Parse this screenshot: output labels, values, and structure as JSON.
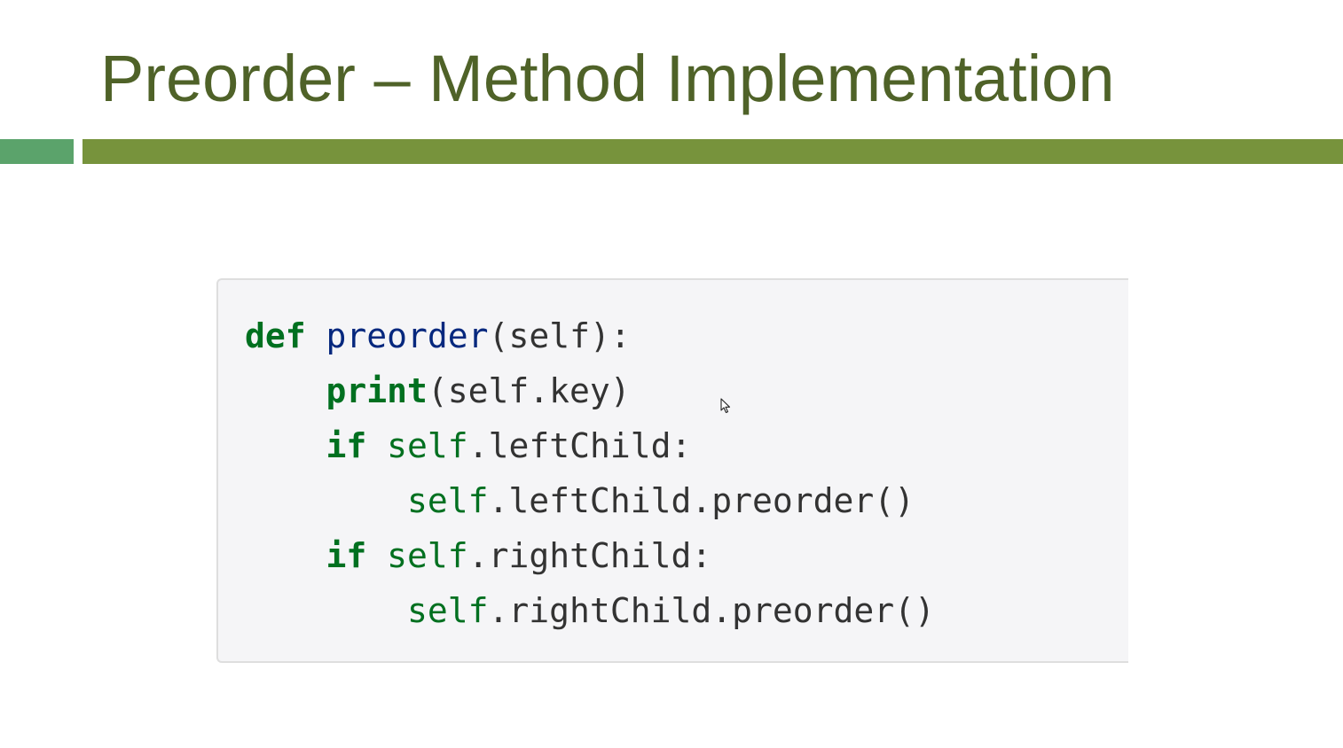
{
  "slide": {
    "title": "Preorder – Method Implementation"
  },
  "code": {
    "lines": [
      [
        {
          "text": "def",
          "kind": "kw"
        },
        {
          "text": " ",
          "kind": "pn"
        },
        {
          "text": "preorder",
          "kind": "fn"
        },
        {
          "text": "(self):",
          "kind": "pn"
        }
      ],
      [
        {
          "text": "    ",
          "kind": "pn"
        },
        {
          "text": "print",
          "kind": "kw"
        },
        {
          "text": "(self.key)",
          "kind": "pn"
        }
      ],
      [
        {
          "text": "    ",
          "kind": "pn"
        },
        {
          "text": "if",
          "kind": "kw"
        },
        {
          "text": " ",
          "kind": "pn"
        },
        {
          "text": "self",
          "kind": "bi"
        },
        {
          "text": ".leftChild:",
          "kind": "pn"
        }
      ],
      [
        {
          "text": "        ",
          "kind": "pn"
        },
        {
          "text": "self",
          "kind": "bi"
        },
        {
          "text": ".leftChild.preorder()",
          "kind": "pn"
        }
      ],
      [
        {
          "text": "    ",
          "kind": "pn"
        },
        {
          "text": "if",
          "kind": "kw"
        },
        {
          "text": " ",
          "kind": "pn"
        },
        {
          "text": "self",
          "kind": "bi"
        },
        {
          "text": ".rightChild:",
          "kind": "pn"
        }
      ],
      [
        {
          "text": "        ",
          "kind": "pn"
        },
        {
          "text": "self",
          "kind": "bi"
        },
        {
          "text": ".rightChild.preorder()",
          "kind": "pn"
        }
      ]
    ]
  },
  "icons": {
    "cursor": "mouse-pointer-icon"
  },
  "colors": {
    "title": "#4f6228",
    "bar_main": "#77933c",
    "bar_accent": "#5ba36b",
    "code_background": "#f5f5f7",
    "keyword": "#007020",
    "function_name": "#06287e"
  }
}
